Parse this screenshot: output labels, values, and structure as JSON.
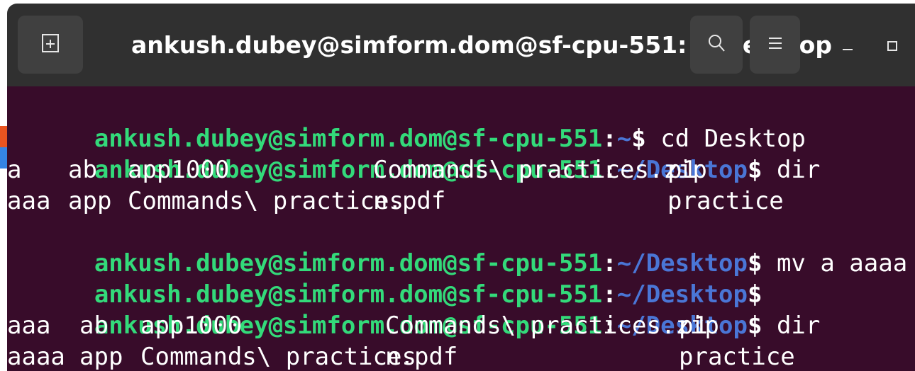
{
  "window": {
    "title": "ankush.dubey@simform.dom@sf-cpu-551: ~/Desktop"
  },
  "icons": {
    "new_tab": "new-tab-icon",
    "search": "search-icon",
    "menu": "hamburger-menu-icon",
    "minimize": "minimize-icon",
    "maximize": "maximize-icon"
  },
  "colors": {
    "titlebar": "#303030",
    "terminal_bg": "#380C2A",
    "prompt_user": "#33DA7A",
    "prompt_path": "#4A76D6",
    "text": "#FFFFFF"
  },
  "terminal": {
    "prompt_user": "ankush.dubey@simform.dom@sf-cpu-551",
    "colon": ":",
    "dollar": "$",
    "lines": [
      {
        "type": "prompt",
        "path": "~",
        "command": " cd Desktop"
      },
      {
        "type": "prompt",
        "path": "~/Desktop",
        "command": " dir"
      },
      {
        "type": "output",
        "cells": [
          "a",
          "ab",
          "app1000",
          "Commands\\ practices.zip",
          "p1"
        ]
      },
      {
        "type": "output",
        "cells": [
          "aaa",
          "app",
          "Commands\\ practices",
          "n.pdf",
          "practice"
        ]
      },
      {
        "type": "prompt",
        "path": "~/Desktop",
        "command": " mv a aaaa"
      },
      {
        "type": "prompt",
        "path": "~/Desktop",
        "command": ""
      },
      {
        "type": "prompt",
        "path": "~/Desktop",
        "command": " dir"
      },
      {
        "type": "output",
        "cells": [
          "aaa",
          "ab",
          "app1000",
          "Commands\\ practices.zip",
          "p1"
        ]
      },
      {
        "type": "output",
        "cells": [
          "aaaa",
          "app",
          "Commands\\ practices",
          "n.pdf",
          "practice"
        ]
      }
    ]
  }
}
